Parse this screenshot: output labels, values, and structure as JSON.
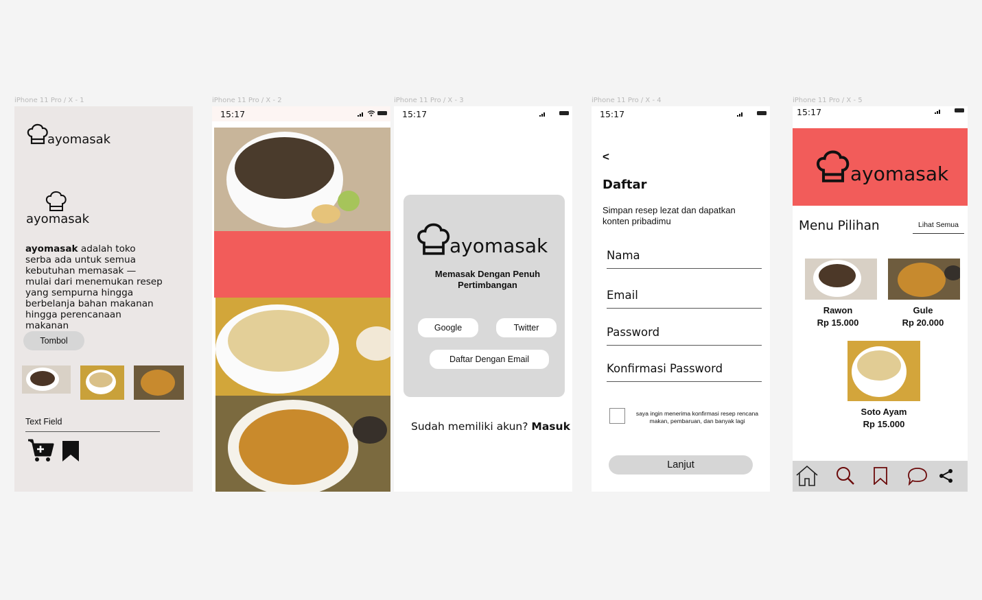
{
  "artboard_labels": [
    "iPhone 11 Pro / X - 1",
    "iPhone 11 Pro / X - 2",
    "iPhone 11 Pro / X - 3",
    "iPhone 11 Pro / X - 4",
    "iPhone 11 Pro / X - 5"
  ],
  "status_time": "15:17",
  "brand": "ayomasak",
  "screen1": {
    "brand_bold": "ayomasak",
    "description": " adalah toko serba ada untuk semua  kebutuhan memasak — mulai dari menemukan resep yang sempurna hingga berbelanja bahan makanan hingga perencanaan makanan",
    "button_label": "Tombol",
    "text_field_label": "Text Field"
  },
  "screen3": {
    "tagline": "Memasak Dengan Penuh Pertimbangan",
    "google": "Google",
    "twitter": "Twitter",
    "email_signup": "Daftar Dengan Email",
    "have_account": "Sudah memiliki akun? ",
    "login": "Masuk"
  },
  "screen4": {
    "back": "<",
    "title": "Daftar",
    "subtitle": "Simpan resep lezat dan dapatkan konten pribadimu",
    "fields": [
      "Nama",
      "Email",
      "Password",
      "Konfirmasi Password"
    ],
    "consent": "saya ingin menerima konfirmasi resep rencana makan, pembaruan, dan banyak lagi",
    "next": "Lanjut"
  },
  "screen5": {
    "section_title": "Menu Pilihan",
    "see_all": "Lihat Semua",
    "dishes": [
      {
        "name": "Rawon",
        "price": "Rp 15.000"
      },
      {
        "name": "Gule",
        "price": "Rp 20.000"
      },
      {
        "name": "Soto Ayam",
        "price": "Rp 15.000"
      }
    ],
    "nav_icons": [
      "home-icon",
      "search-icon",
      "bookmark-icon",
      "chat-icon",
      "share-icon"
    ]
  },
  "colors": {
    "accent": "#f25c5a",
    "canvas": "#f4f4f4",
    "board1_bg": "#ebe7e6",
    "card_gray": "#d9d9d9"
  }
}
